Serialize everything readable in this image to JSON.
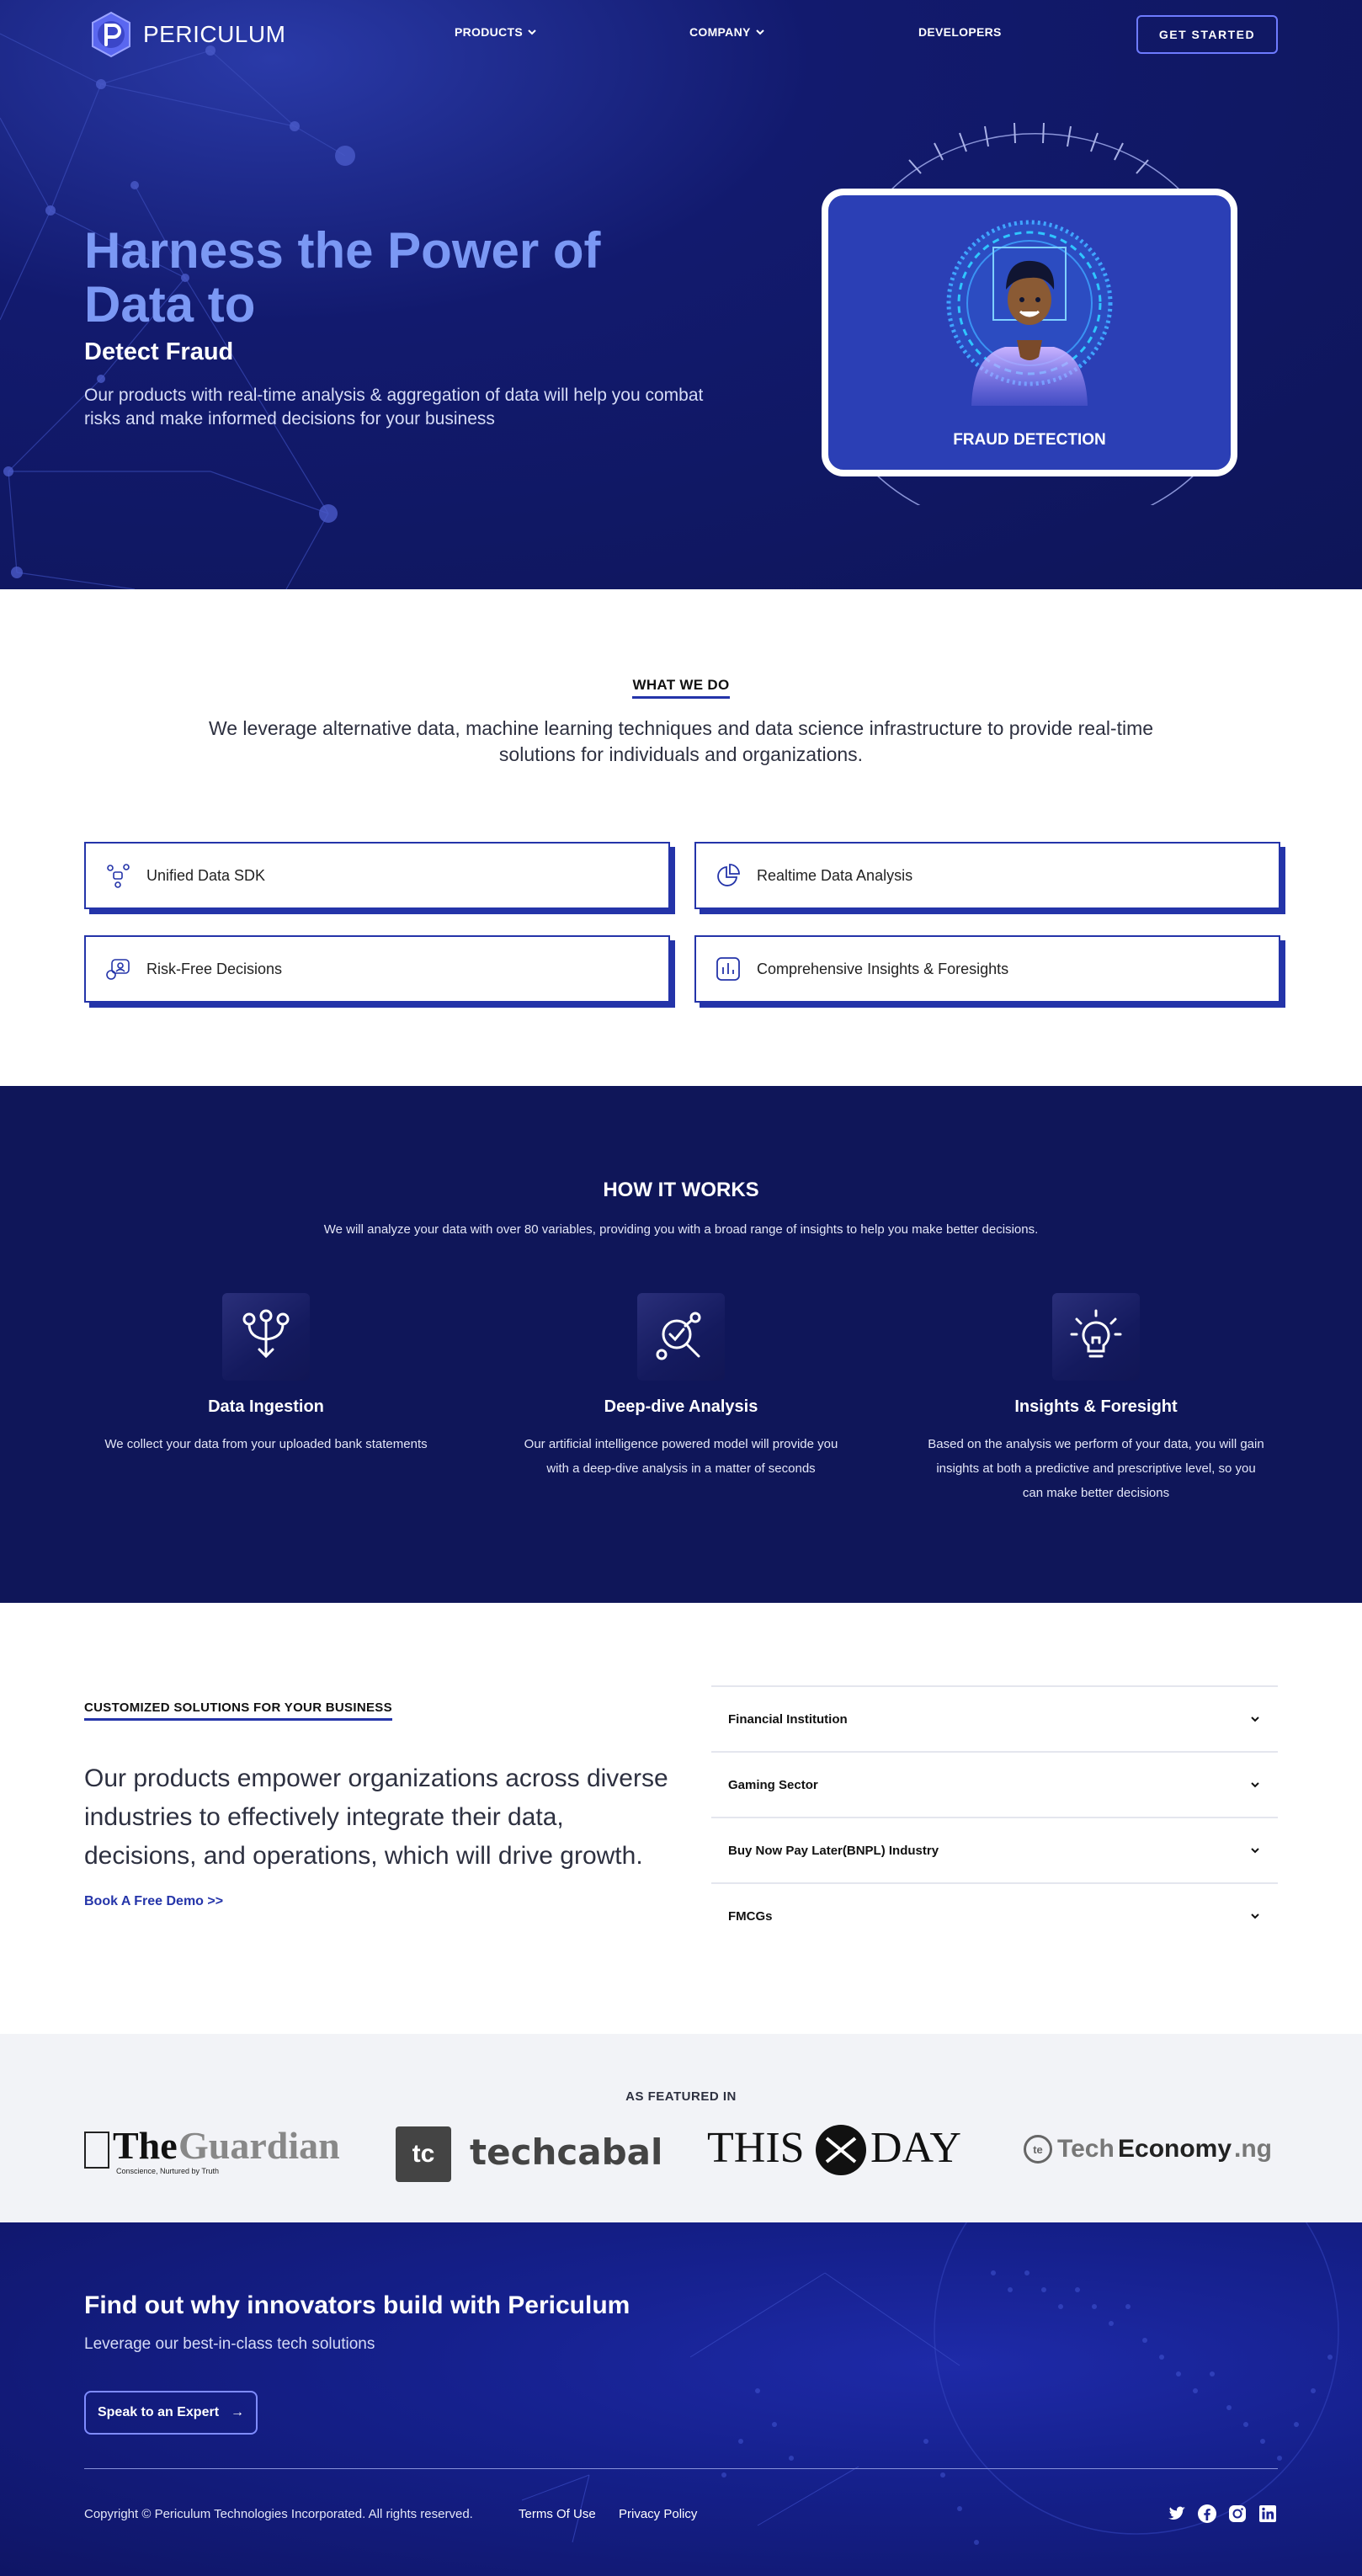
{
  "nav": {
    "brand": "PERICULUM",
    "products": "PRODUCTS",
    "company": "COMPANY",
    "developers": "DEVELOPERS",
    "cta": "GET STARTED"
  },
  "hero": {
    "title": "Harness the Power of Data to",
    "subtitle": "Detect Fraud",
    "description": "Our products with real-time analysis & aggregation of data will help you combat risks and make informed decisions for your business",
    "card_label": "FRAUD DETECTION"
  },
  "what_we_do": {
    "label": "WHAT WE DO",
    "description": "We leverage alternative data, machine learning techniques and data science infrastructure to provide real-time solutions for individuals and organizations.",
    "features": [
      {
        "label": "Unified Data SDK",
        "icon": "sdk-icon"
      },
      {
        "label": "Realtime Data Analysis",
        "icon": "pie-chart-icon"
      },
      {
        "label": "Risk-Free Decisions",
        "icon": "decision-icon"
      },
      {
        "label": "Comprehensive Insights & Foresights",
        "icon": "bar-chart-icon"
      }
    ]
  },
  "how_it_works": {
    "title": "HOW IT WORKS",
    "description": "We will analyze your data with over 80 variables, providing you with a broad range of insights to help you make better decisions.",
    "steps": [
      {
        "title": "Data Ingestion",
        "description": "We collect your data from your uploaded bank statements",
        "icon": "ingestion-icon"
      },
      {
        "title": "Deep-dive Analysis",
        "description": "Our artificial intelligence powered model will provide you with a deep-dive analysis in a matter of seconds",
        "icon": "analysis-icon"
      },
      {
        "title": "Insights & Foresight",
        "description": "Based on the analysis we perform of your data, you will gain insights at both a predictive and prescriptive level, so you can make better decisions",
        "icon": "lightbulb-icon"
      }
    ]
  },
  "solutions": {
    "label": "CUSTOMIZED SOLUTIONS FOR YOUR BUSINESS",
    "text": "Our products empower organizations across diverse industries to effectively integrate their data, decisions, and operations, which will drive growth.",
    "link": "Book A Free Demo >>",
    "accordion": [
      "Financial Institution",
      "Gaming Sector",
      "Buy Now Pay Later(BNPL) Industry",
      "FMCGs"
    ]
  },
  "featured": {
    "title": "AS FEATURED IN",
    "guardian_main": "The",
    "guardian_second": "Guardian",
    "guardian_tag": "Conscience, Nurtured by Truth",
    "techcabal_mark": "tc",
    "techcabal": "techcabal",
    "thisday_left": "THIS",
    "thisday_right": "DAY",
    "techeconomy_tech": "Tech",
    "techeconomy_eco": "Economy",
    "techeconomy_ng": ".ng",
    "techeconomy_mark": "te"
  },
  "cta": {
    "title": "Find out why innovators build with Periculum",
    "subtitle": "Leverage our best-in-class tech solutions",
    "button": "Speak to an Expert",
    "button_arrow": "→"
  },
  "footer": {
    "copyright": "Copyright © Periculum Technologies Incorporated. All rights reserved.",
    "terms": "Terms Of Use",
    "privacy": "Privacy Policy",
    "social": [
      "twitter-icon",
      "facebook-icon",
      "instagram-icon",
      "linkedin-icon"
    ]
  },
  "colors": {
    "navy": "#0f1659",
    "accent_blue": "#2434a9",
    "hero_title": "#7b98f4",
    "card_blue": "#2b3fb5",
    "light_gray": "#f2f3f7"
  }
}
